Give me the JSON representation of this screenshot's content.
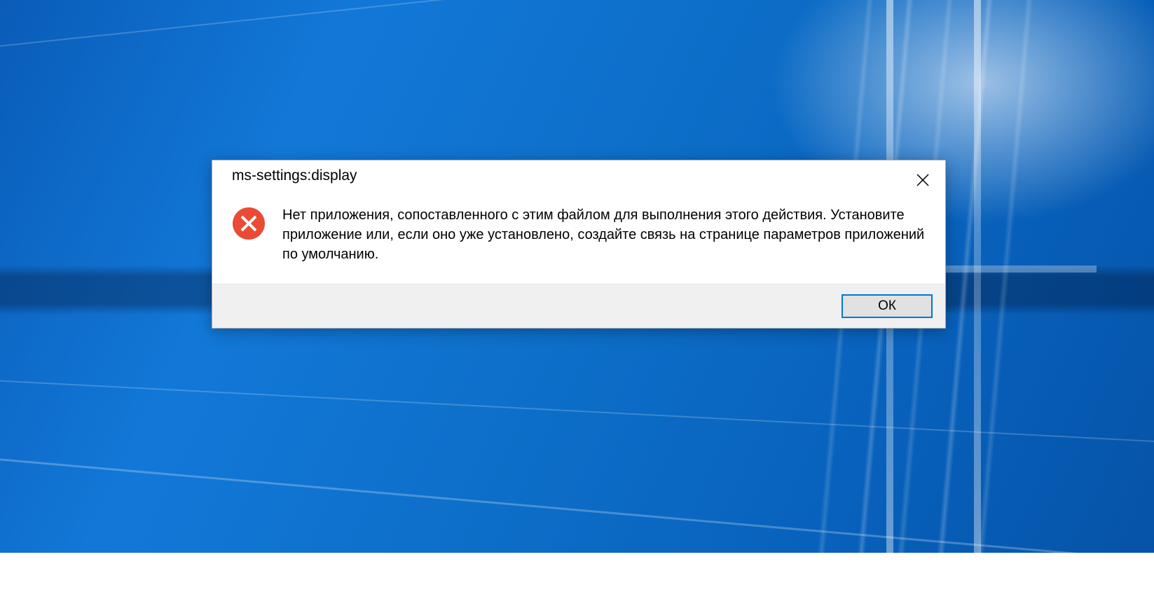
{
  "dialog": {
    "title": "ms-settings:display",
    "message": "Нет приложения, сопоставленного с этим файлом для выполнения этого действия. Установите приложение или, если оно уже установлено, создайте связь на странице параметров приложений по умолчанию.",
    "ok_label": "ОК",
    "icon_color": "#e94b35"
  }
}
